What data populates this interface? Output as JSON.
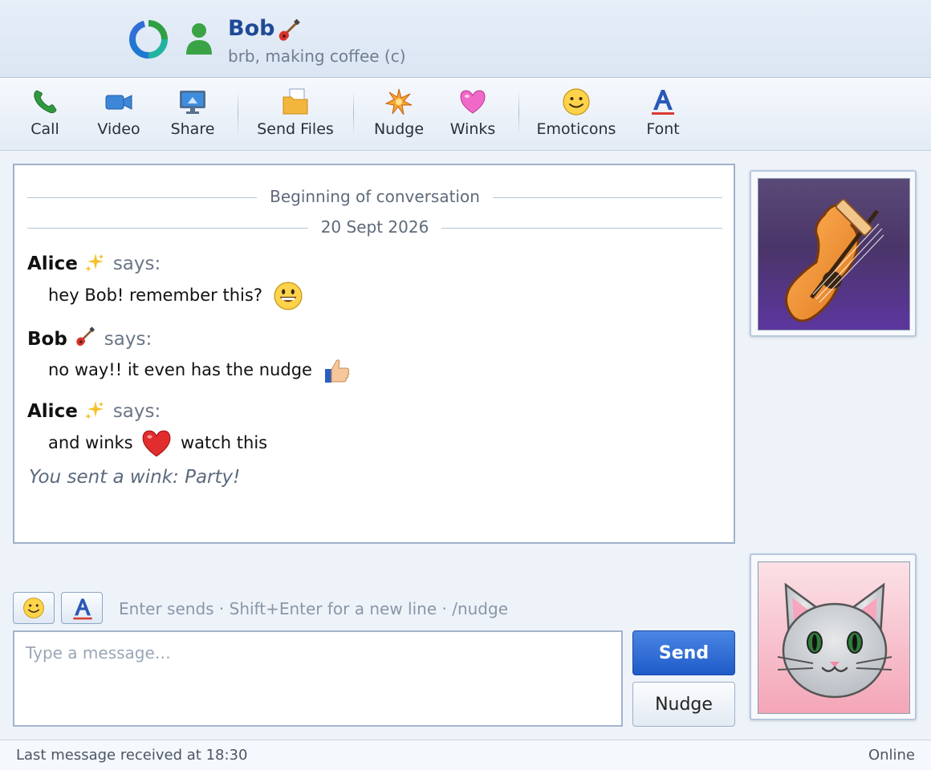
{
  "header": {
    "contact_name": "Bob",
    "contact_status": "brb, making coffee (c)"
  },
  "toolbar": {
    "call": "Call",
    "video": "Video",
    "share": "Share",
    "send_files": "Send Files",
    "nudge": "Nudge",
    "winks": "Winks",
    "emoticons": "Emoticons",
    "font": "Font"
  },
  "conversation": {
    "beginning": "Beginning of conversation",
    "date": "20 Sept 2026",
    "says": "says:",
    "messages": [
      {
        "sender": "Alice",
        "text": "hey Bob! remember this?"
      },
      {
        "sender": "Bob",
        "text": "no way!! it even has the nudge"
      },
      {
        "sender": "Alice",
        "text_before": "and winks",
        "text_after": "watch this"
      }
    ],
    "wink_note": "You sent a wink: Party!"
  },
  "compose": {
    "hint": "Enter sends · Shift+Enter for a new line · /nudge",
    "placeholder": "Type a message…",
    "send": "Send",
    "nudge": "Nudge"
  },
  "statusbar": {
    "last_message": "Last message received at 18:30",
    "presence": "Online"
  },
  "colors": {
    "accent": "#1f5bc8",
    "name": "#1e4a96",
    "presence_green": "#2ea043"
  },
  "icons": [
    "ring-icon",
    "person-icon",
    "guitar-icon",
    "phone-icon",
    "video-camera-icon",
    "monitor-icon",
    "folder-icon",
    "nudge-star-icon",
    "heart-icon",
    "smiley-icon",
    "font-a-icon",
    "sparkles-icon",
    "grin-icon",
    "thumbs-up-icon"
  ]
}
